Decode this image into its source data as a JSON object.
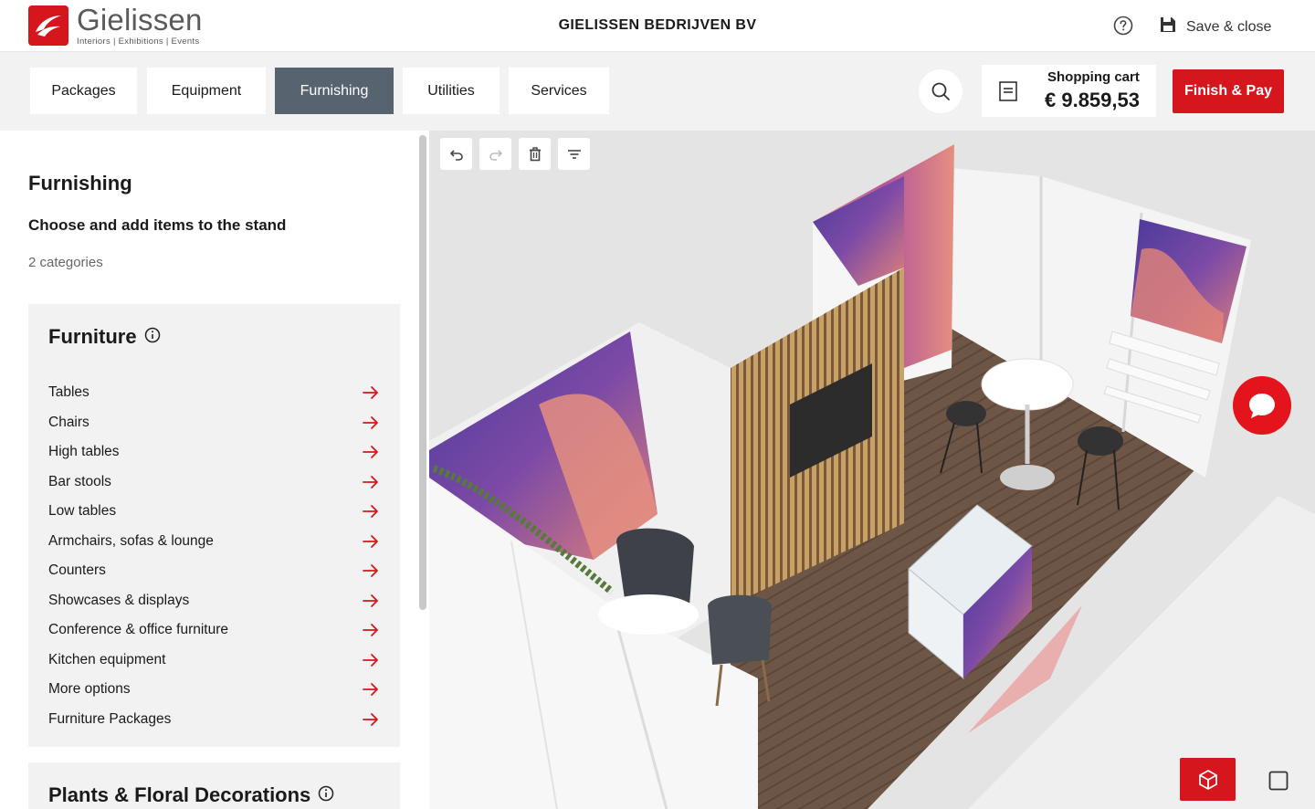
{
  "header": {
    "logo_name": "Gielissen",
    "logo_tagline": "Interiors  |  Exhibitions  |  Events",
    "company": "GIELISSEN BEDRIJVEN BV",
    "save_close_label": "Save & close",
    "help_icon": "question-circle-icon",
    "save_icon": "floppy-disk-icon"
  },
  "nav": {
    "tabs": [
      {
        "label": "Packages"
      },
      {
        "label": "Equipment"
      },
      {
        "label": "Furnishing"
      },
      {
        "label": "Utilities"
      },
      {
        "label": "Services"
      }
    ],
    "active_tab": "Furnishing",
    "cart_label": "Shopping cart",
    "cart_total": "€ 9.859,53",
    "finish_label": "Finish & Pay"
  },
  "panel": {
    "title": "Furnishing",
    "subtitle": "Choose and add items to the stand",
    "count": "2 categories",
    "furniture": {
      "title": "Furniture",
      "items": [
        "Tables",
        "Chairs",
        "High tables",
        "Bar stools",
        "Low tables",
        "Armchairs, sofas & lounge",
        "Counters",
        "Showcases & displays",
        "Conference & office furniture",
        "Kitchen equipment",
        "More options",
        "Furniture Packages"
      ]
    },
    "plants": {
      "title": "Plants & Floral Decorations"
    }
  },
  "canvas_tools": [
    "undo-icon",
    "redo-icon",
    "trash-icon",
    "filter-icon"
  ],
  "colors": {
    "brand_red": "#d5161c",
    "active_tab": "#576470",
    "panel_bg": "#f2f2f2"
  }
}
